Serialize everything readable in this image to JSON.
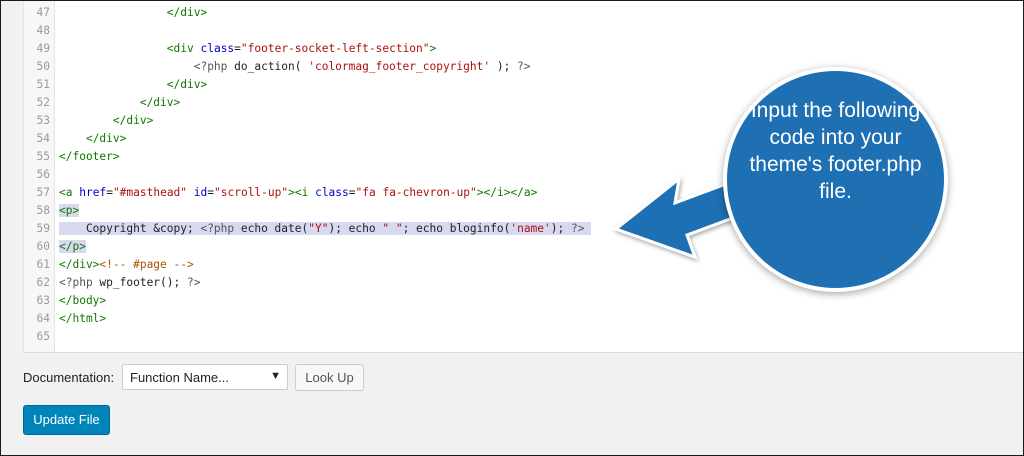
{
  "editor": {
    "lines": [
      {
        "n": "47",
        "html": "                <span class='tag2'>&lt;/div&gt;</span>"
      },
      {
        "n": "48",
        "html": ""
      },
      {
        "n": "49",
        "html": "                <span class='tag2'>&lt;div</span> <span class='atn'>class</span>=<span class='str'>\"footer-socket-left-section\"</span><span class='tag2'>&gt;</span>"
      },
      {
        "n": "50",
        "html": "                    <span class='php'>&lt;?php</span> do_action( <span class='str'>'colormag_footer_copyright'</span> ); <span class='php'>?&gt;</span>"
      },
      {
        "n": "51",
        "html": "                <span class='tag2'>&lt;/div&gt;</span>"
      },
      {
        "n": "52",
        "html": "            <span class='tag2'>&lt;/div&gt;</span>"
      },
      {
        "n": "53",
        "html": "        <span class='tag2'>&lt;/div&gt;</span>"
      },
      {
        "n": "54",
        "html": "    <span class='tag2'>&lt;/div&gt;</span>"
      },
      {
        "n": "55",
        "html": "<span class='tag2'>&lt;/footer&gt;</span>"
      },
      {
        "n": "56",
        "html": ""
      },
      {
        "n": "57",
        "html": "<span class='tag2'>&lt;a</span> <span class='atn'>href</span>=<span class='str'>\"#masthead\"</span> <span class='atn'>id</span>=<span class='str'>\"scroll-up\"</span><span class='tag2'>&gt;&lt;i</span> <span class='atn'>class</span>=<span class='str'>\"fa fa-chevron-up\"</span><span class='tag2'>&gt;&lt;/i&gt;&lt;/a&gt;</span>"
      },
      {
        "n": "58",
        "html": "<span class='hl'><span class='tag2'>&lt;p&gt;</span></span>"
      },
      {
        "n": "59",
        "html": "<span class='hl'>    Copyright &amp;copy; <span class='php'>&lt;?php</span> echo date(<span class='str'>\"Y\"</span>); echo <span class='str'>\" \"</span>; echo bloginfo(<span class='str'>'name'</span>); <span class='php'>?&gt;</span> </span>"
      },
      {
        "n": "60",
        "html": "<span class='hl'><span class='tag2'>&lt;/p&gt;</span></span>"
      },
      {
        "n": "61",
        "html": "<span class='tag2'>&lt;/div&gt;</span><span class='cmt'>&lt;!-- #page --&gt;</span>"
      },
      {
        "n": "62",
        "html": "<span class='php'>&lt;?php</span> wp_footer(); <span class='php'>?&gt;</span>"
      },
      {
        "n": "63",
        "html": "<span class='tag2'>&lt;/body&gt;</span>"
      },
      {
        "n": "64",
        "html": "<span class='tag2'>&lt;/html&gt;</span>"
      },
      {
        "n": "65",
        "html": ""
      }
    ]
  },
  "toolbar": {
    "documentation_label": "Documentation:",
    "function_select_value": "Function Name...",
    "lookup_label": "Look Up",
    "update_label": "Update File"
  },
  "callout": {
    "text": "Input the following code into your theme's footer.php file.",
    "color": "#1f6fb3"
  }
}
